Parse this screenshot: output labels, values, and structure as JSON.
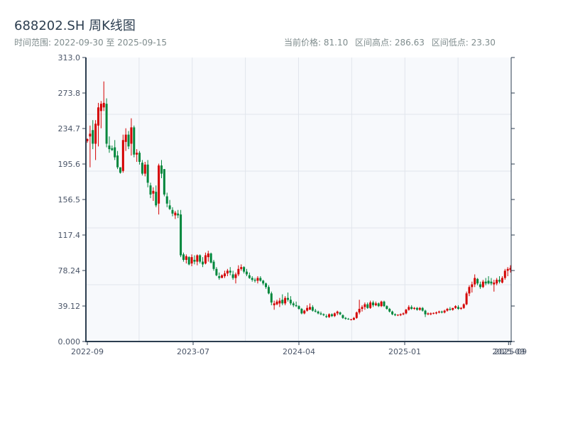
{
  "header": {
    "title": "688202.SH 周K线图",
    "range_label": "时间范围: 2022-09-30 至 2025-09-15",
    "current_price": "当前价格: 81.10",
    "range_high": "区间高点: 286.63",
    "range_low": "区间低点: 23.30"
  },
  "colors": {
    "up": "#d40000",
    "down": "#00873c",
    "plot_bg": "#f7f9fc",
    "grid": "#e1e5ec",
    "axis": "#2c3e50"
  },
  "chart_data": {
    "type": "candlestick",
    "title": "688202.SH 周K线图",
    "interval": "weekly",
    "x_range": [
      "2022-09-30",
      "2025-09-15"
    ],
    "ylim": [
      0,
      313.0
    ],
    "grid": true,
    "yticks": [
      "0.000",
      "39.12",
      "78.24",
      "117.4",
      "156.5",
      "195.6",
      "234.7",
      "273.8",
      "313.0"
    ],
    "xticks": [
      {
        "label": "2022-09",
        "index": 0
      },
      {
        "label": "2023-07",
        "index": 38.5
      },
      {
        "label": "2024-04",
        "index": 77
      },
      {
        "label": "2025-01",
        "index": 115.5
      },
      {
        "label": "2025-09",
        "index": 153.3
      },
      {
        "label": "2025-09",
        "index": 154
      }
    ],
    "ohlc": [
      [
        221,
        224,
        219,
        223
      ],
      [
        226,
        238,
        192,
        229
      ],
      [
        233,
        244,
        212,
        218
      ],
      [
        218,
        244,
        200,
        240
      ],
      [
        238,
        263,
        215,
        258
      ],
      [
        254,
        265,
        235,
        262
      ],
      [
        258,
        286.63,
        254,
        263
      ],
      [
        262,
        268,
        214,
        218
      ],
      [
        216,
        226,
        208,
        212
      ],
      [
        213,
        216,
        210,
        211
      ],
      [
        214,
        222,
        200,
        203
      ],
      [
        205,
        210,
        190,
        192
      ],
      [
        192,
        192,
        185,
        186
      ],
      [
        188,
        228,
        186,
        222
      ],
      [
        220,
        235,
        210,
        228
      ],
      [
        228,
        232,
        212,
        215
      ],
      [
        218,
        246,
        205,
        236
      ],
      [
        236,
        238,
        203,
        206
      ],
      [
        206,
        212,
        198,
        208
      ],
      [
        208,
        210,
        195,
        198
      ],
      [
        197,
        200,
        183,
        185
      ],
      [
        185,
        198,
        182,
        195
      ],
      [
        195,
        200,
        170,
        175
      ],
      [
        172,
        175,
        158,
        162
      ],
      [
        163,
        170,
        155,
        166
      ],
      [
        165,
        172,
        148,
        150
      ],
      [
        152,
        196,
        140,
        194
      ],
      [
        194,
        200,
        180,
        185
      ],
      [
        190,
        190,
        160,
        162
      ],
      [
        160,
        164,
        148,
        152
      ],
      [
        150,
        156,
        145,
        146
      ],
      [
        145,
        148,
        138,
        141
      ],
      [
        139,
        144,
        135,
        142
      ],
      [
        141,
        145,
        136,
        139
      ],
      [
        140,
        145,
        93,
        95
      ],
      [
        96,
        98,
        88,
        90
      ],
      [
        90,
        96,
        86,
        94
      ],
      [
        93,
        94,
        84,
        85
      ],
      [
        86,
        96,
        83,
        93
      ],
      [
        90,
        95,
        85,
        88
      ],
      [
        88,
        96,
        84,
        95
      ],
      [
        95,
        96,
        86,
        88
      ],
      [
        88,
        93,
        82,
        85
      ],
      [
        86,
        98,
        85,
        95
      ],
      [
        93,
        100,
        88,
        97
      ],
      [
        97,
        98,
        86,
        87
      ],
      [
        88,
        90,
        78,
        80
      ],
      [
        80,
        82,
        72,
        73
      ],
      [
        72,
        76,
        68,
        70
      ],
      [
        70,
        74,
        70,
        73
      ],
      [
        72,
        78,
        70,
        75
      ],
      [
        75,
        80,
        72,
        78
      ],
      [
        78,
        82,
        73,
        76
      ],
      [
        74,
        78,
        68,
        70
      ],
      [
        70,
        76,
        64,
        74
      ],
      [
        74,
        84,
        72,
        80
      ],
      [
        80,
        85,
        78,
        82
      ],
      [
        82,
        83,
        75,
        77
      ],
      [
        77,
        80,
        72,
        74
      ],
      [
        73,
        76,
        69,
        70
      ],
      [
        70,
        72,
        66,
        68
      ],
      [
        68,
        70,
        65,
        67
      ],
      [
        67,
        72,
        64,
        70
      ],
      [
        70,
        72,
        66,
        67
      ],
      [
        67,
        68,
        62,
        64
      ],
      [
        64,
        65,
        58,
        60
      ],
      [
        60,
        62,
        52,
        53
      ],
      [
        53,
        55,
        40,
        43
      ],
      [
        40,
        45,
        35,
        42
      ],
      [
        41,
        46,
        40,
        44
      ],
      [
        42,
        48,
        38,
        45
      ],
      [
        46,
        52,
        40,
        42
      ],
      [
        42,
        50,
        40,
        48
      ],
      [
        48,
        54,
        44,
        46
      ],
      [
        46,
        50,
        40,
        42
      ],
      [
        42,
        44,
        38,
        40
      ],
      [
        40,
        44,
        38,
        39
      ],
      [
        39,
        40,
        35,
        36
      ],
      [
        36,
        37,
        30,
        31
      ],
      [
        31,
        35,
        30,
        34
      ],
      [
        34,
        40,
        33,
        37
      ],
      [
        35,
        42,
        35,
        38
      ],
      [
        38,
        40,
        33,
        34
      ],
      [
        34,
        36,
        32,
        33
      ],
      [
        33,
        34,
        30,
        31
      ],
      [
        31,
        33,
        29,
        30
      ],
      [
        30,
        31,
        28,
        29
      ],
      [
        28,
        30,
        26,
        27
      ],
      [
        27,
        31,
        26,
        30
      ],
      [
        30,
        31,
        27,
        28
      ],
      [
        28,
        32,
        27,
        31
      ],
      [
        31,
        34,
        29,
        33
      ],
      [
        32,
        33,
        29,
        30
      ],
      [
        29,
        30,
        25,
        26
      ],
      [
        26,
        27,
        24,
        25
      ],
      [
        25,
        26,
        24,
        24.5
      ],
      [
        24,
        25,
        23.3,
        24.5
      ],
      [
        24,
        27,
        23.5,
        26
      ],
      [
        26,
        33,
        25,
        32
      ],
      [
        32,
        46,
        30,
        36
      ],
      [
        36,
        40,
        33,
        38
      ],
      [
        38,
        43,
        35,
        41
      ],
      [
        41,
        43,
        36,
        37
      ],
      [
        37,
        45,
        36,
        43
      ],
      [
        43,
        45,
        38,
        40
      ],
      [
        40,
        44,
        39,
        42
      ],
      [
        42,
        43,
        38,
        39
      ],
      [
        39,
        45,
        38,
        44
      ],
      [
        44,
        45,
        38,
        39
      ],
      [
        39,
        40,
        35,
        36
      ],
      [
        36,
        37,
        32,
        33
      ],
      [
        33,
        34,
        29,
        30
      ],
      [
        30,
        31,
        28,
        29
      ],
      [
        29,
        30,
        28,
        29.5
      ],
      [
        29,
        31,
        28,
        30
      ],
      [
        30,
        32,
        29,
        31
      ],
      [
        31,
        36,
        30,
        35
      ],
      [
        35,
        40,
        34,
        38
      ],
      [
        38,
        40,
        35,
        36
      ],
      [
        36,
        38,
        35,
        37
      ],
      [
        37,
        38,
        34,
        35
      ],
      [
        35,
        38,
        34,
        37
      ],
      [
        37,
        38,
        33,
        34
      ],
      [
        34,
        35,
        27,
        30
      ],
      [
        30,
        32,
        29,
        31
      ],
      [
        30,
        32,
        29,
        31
      ],
      [
        31,
        32,
        30,
        31.5
      ],
      [
        31,
        33,
        30,
        32
      ],
      [
        32,
        34,
        31,
        33
      ],
      [
        33,
        34,
        31,
        32
      ],
      [
        32,
        35,
        31,
        34
      ],
      [
        34,
        37,
        33,
        36
      ],
      [
        36,
        38,
        34,
        35
      ],
      [
        35,
        37,
        34,
        37
      ],
      [
        37,
        40,
        36,
        39
      ],
      [
        38,
        40,
        35,
        36
      ],
      [
        36,
        38,
        35,
        37
      ],
      [
        37,
        42,
        36,
        41
      ],
      [
        41,
        55,
        40,
        53
      ],
      [
        53,
        62,
        50,
        60
      ],
      [
        60,
        66,
        54,
        63
      ],
      [
        63,
        74,
        60,
        70
      ],
      [
        69,
        70,
        62,
        64
      ],
      [
        63,
        66,
        58,
        60
      ],
      [
        60,
        68,
        59,
        66
      ],
      [
        66,
        70,
        62,
        64
      ],
      [
        67,
        72,
        63,
        64
      ],
      [
        66,
        70,
        62,
        64
      ],
      [
        63,
        68,
        55,
        65
      ],
      [
        64,
        70,
        62,
        68
      ],
      [
        68,
        72,
        64,
        66
      ],
      [
        65,
        72,
        64,
        70
      ],
      [
        70,
        80,
        68,
        78
      ],
      [
        78,
        82,
        72,
        80
      ],
      [
        79,
        84,
        76,
        81.1
      ]
    ]
  }
}
